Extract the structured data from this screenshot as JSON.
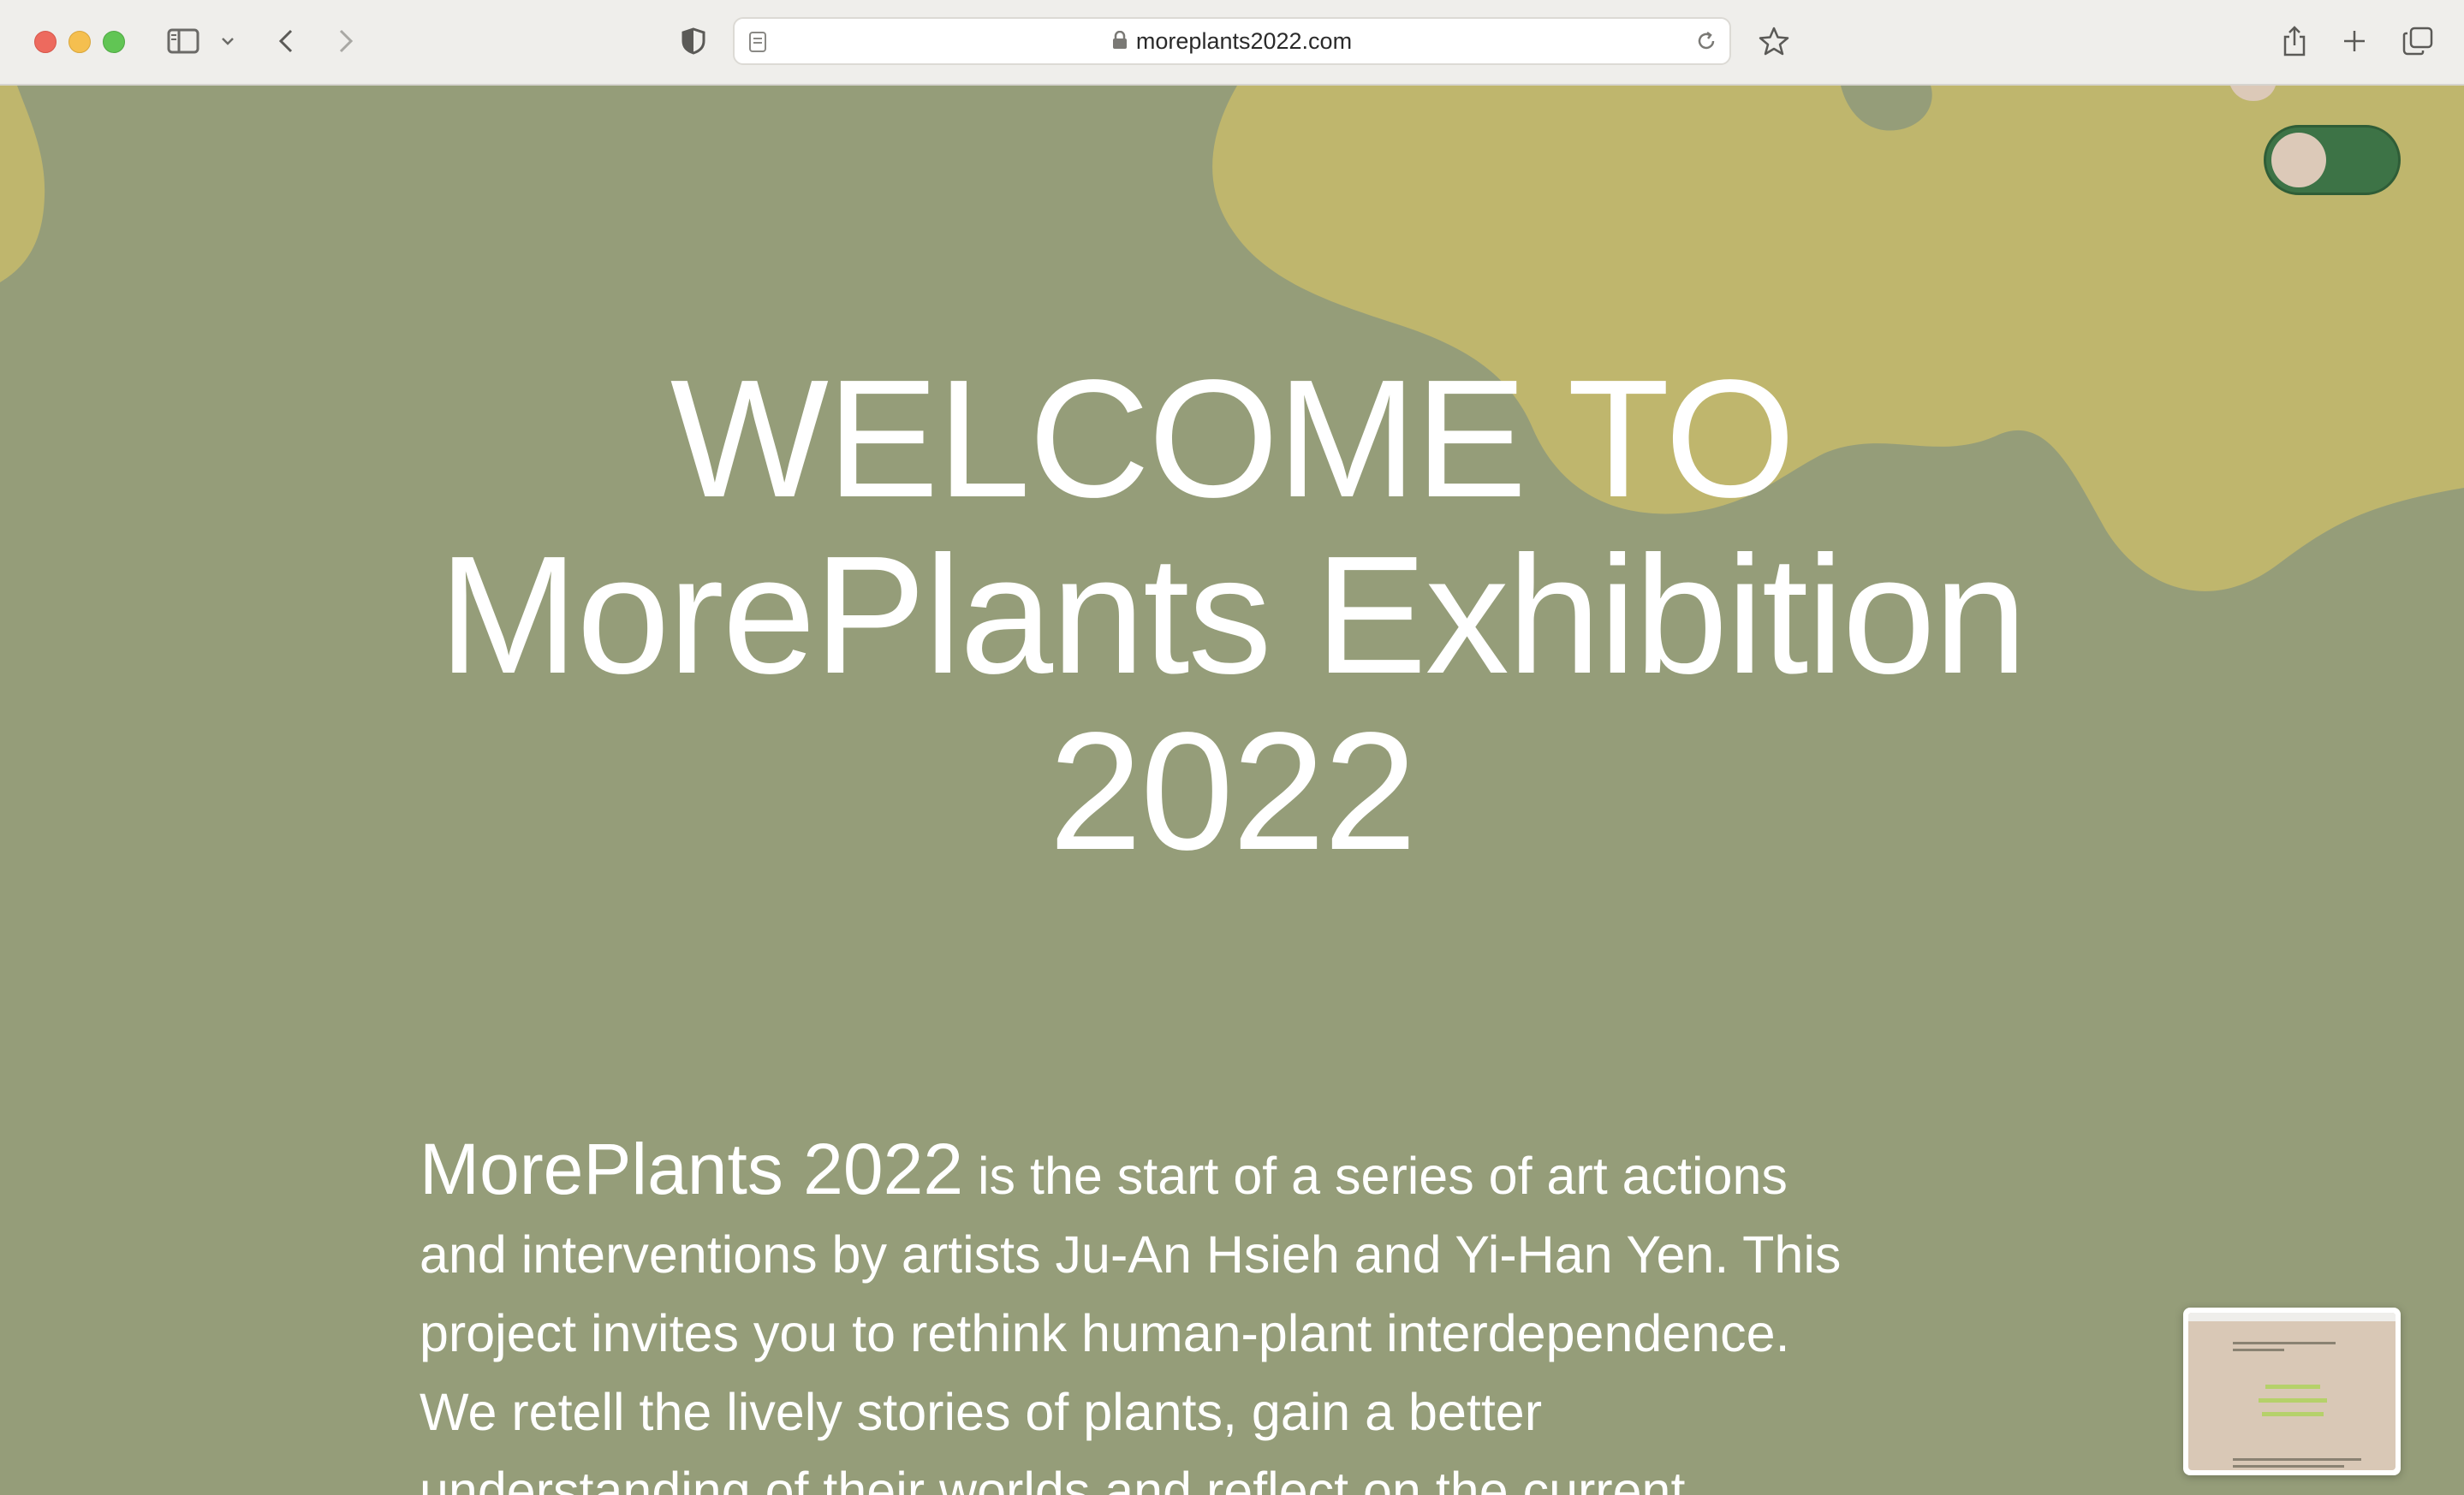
{
  "browser": {
    "url": "moreplants2022.com"
  },
  "hero": {
    "line1": "WELCOME TO",
    "line2": "MorePlants Exhibition",
    "line3": "2022"
  },
  "intro": {
    "lead": "MorePlants 2022",
    "line1": " is the start of a series of art actions",
    "line2": "and interventions by artists Ju-An Hsieh and Yi-Han Yen. This",
    "line3": "project invites you to rethink human-plant interdependence.",
    "line4": "We retell the lively stories of plants, gain a better",
    "line5": "understanding of their worlds and reflect on the current"
  },
  "colors": {
    "background": "#959d79",
    "blob": "#bfb66d",
    "toggle": "#3d7346",
    "knob": "#dcc9b8"
  },
  "theme_toggle": {
    "state": "on"
  }
}
